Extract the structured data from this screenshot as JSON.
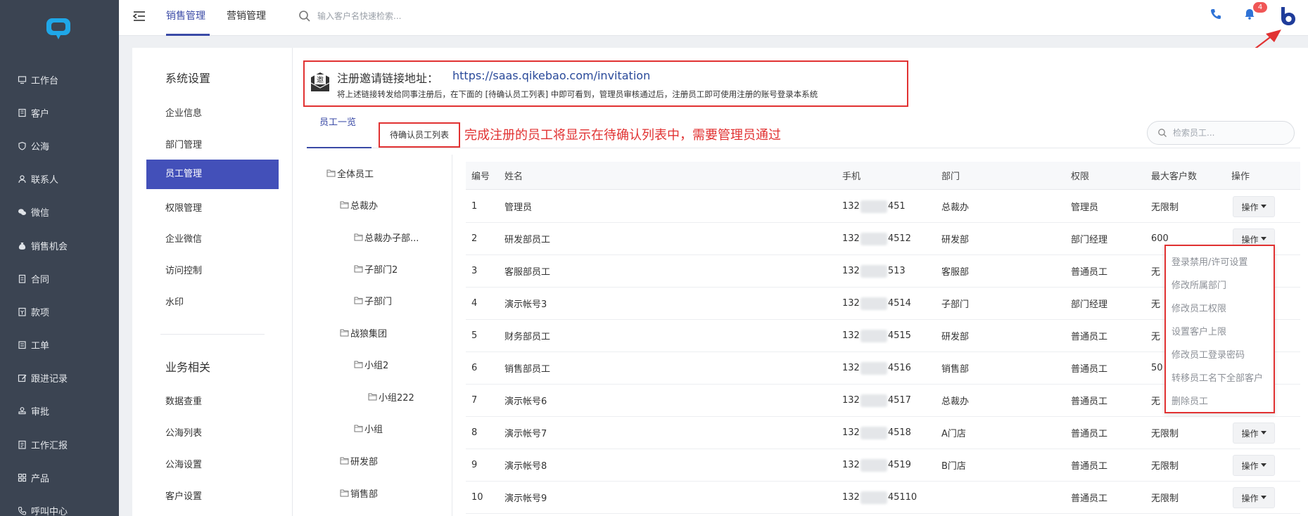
{
  "sidebar": {
    "items": [
      {
        "label": "工作台",
        "icon": "monitor-icon"
      },
      {
        "label": "客户",
        "icon": "building-icon"
      },
      {
        "label": "公海",
        "icon": "shield-icon"
      },
      {
        "label": "联系人",
        "icon": "person-icon"
      },
      {
        "label": "微信",
        "icon": "wechat-icon"
      },
      {
        "label": "销售机会",
        "icon": "money-bag-icon"
      },
      {
        "label": "合同",
        "icon": "document-icon"
      },
      {
        "label": "款项",
        "icon": "receipt-icon"
      },
      {
        "label": "工单",
        "icon": "ticket-icon"
      },
      {
        "label": "跟进记录",
        "icon": "edit-icon"
      },
      {
        "label": "审批",
        "icon": "stamp-icon"
      },
      {
        "label": "工作汇报",
        "icon": "report-icon"
      },
      {
        "label": "产品",
        "icon": "grid-icon"
      },
      {
        "label": "呼叫中心",
        "icon": "phone-icon"
      }
    ]
  },
  "topbar": {
    "tabs": [
      "销售管理",
      "营销管理"
    ],
    "active_tab": "销售管理",
    "search_placeholder": "输入客户名快速检索...",
    "notification_count": "4"
  },
  "settings_nav": {
    "group1_title": "系统设置",
    "group1_items": [
      "企业信息",
      "部门管理",
      "员工管理",
      "权限管理",
      "企业微信",
      "访问控制",
      "水印"
    ],
    "active_item": "员工管理",
    "group2_title": "业务相关",
    "group2_items": [
      "数据查重",
      "公海列表",
      "公海设置",
      "客户设置"
    ]
  },
  "invite": {
    "label": "注册邀请链接地址：",
    "url": "https://saas.qikebao.com/invitation",
    "description": "将上述链接转发给同事注册后，在下面的 [待确认员工列表] 中即可看到，管理员审核通过后，注册员工即可使用注册的账号登录本系统"
  },
  "tabs": {
    "staff_list": "员工一览",
    "pending_list": "待确认员工列表",
    "annotation": "完成注册的员工将显示在待确认列表中，需要管理员通过"
  },
  "staff_search_placeholder": "检索员工...",
  "tree": [
    {
      "label": "全体员工",
      "level": 0
    },
    {
      "label": "总裁办",
      "level": 1
    },
    {
      "label": "总裁办子部...",
      "level": 2
    },
    {
      "label": "子部门2",
      "level": 2
    },
    {
      "label": "子部门",
      "level": 2
    },
    {
      "label": "战狼集团",
      "level": 1
    },
    {
      "label": "小组2",
      "level": 2
    },
    {
      "label": "小组222",
      "level": 3
    },
    {
      "label": "小组",
      "level": 2
    },
    {
      "label": "研发部",
      "level": 1
    },
    {
      "label": "销售部",
      "level": 1
    }
  ],
  "table": {
    "columns": [
      "编号",
      "姓名",
      "手机",
      "部门",
      "权限",
      "最大客户数",
      "操作"
    ],
    "op_label": "操作",
    "rows": [
      {
        "id": "1",
        "name": "管理员",
        "phone_prefix": "132",
        "phone_suffix": "451",
        "dept": "总裁办",
        "role": "管理员",
        "max": "无限制"
      },
      {
        "id": "2",
        "name": "研发部员工",
        "phone_prefix": "132",
        "phone_suffix": "4512",
        "dept": "研发部",
        "role": "部门经理",
        "max": "600"
      },
      {
        "id": "3",
        "name": "客服部员工",
        "phone_prefix": "132",
        "phone_suffix": "513",
        "dept": "客服部",
        "role": "普通员工",
        "max": "无"
      },
      {
        "id": "4",
        "name": "演示帐号3",
        "phone_prefix": "132",
        "phone_suffix": "4514",
        "dept": "子部门",
        "role": "部门经理",
        "max": "无"
      },
      {
        "id": "5",
        "name": "财务部员工",
        "phone_prefix": "132",
        "phone_suffix": "4515",
        "dept": "研发部",
        "role": "普通员工",
        "max": "无"
      },
      {
        "id": "6",
        "name": "销售部员工",
        "phone_prefix": "132",
        "phone_suffix": "4516",
        "dept": "销售部",
        "role": "普通员工",
        "max": "50"
      },
      {
        "id": "7",
        "name": "演示帐号6",
        "phone_prefix": "132",
        "phone_suffix": "4517",
        "dept": "总裁办",
        "role": "普通员工",
        "max": "无"
      },
      {
        "id": "8",
        "name": "演示帐号7",
        "phone_prefix": "132",
        "phone_suffix": "4518",
        "dept": "A门店",
        "role": "普通员工",
        "max": "无限制"
      },
      {
        "id": "9",
        "name": "演示帐号8",
        "phone_prefix": "132",
        "phone_suffix": "4519",
        "dept": "B门店",
        "role": "普通员工",
        "max": "无限制"
      },
      {
        "id": "10",
        "name": "演示帐号9",
        "phone_prefix": "132",
        "phone_suffix": "45110",
        "dept": "",
        "role": "普通员工",
        "max": "无限制"
      }
    ]
  },
  "dropdown": {
    "items": [
      "登录禁用/许可设置",
      "修改所属部门",
      "修改员工权限",
      "设置客户上限",
      "修改员工登录密码",
      "转移员工名下全部客户",
      "删除员工"
    ]
  },
  "colors": {
    "sidebar_bg": "#3b4452",
    "accent": "#3a4aa6",
    "active_nav": "#4350b9",
    "annotation_red": "#e13232",
    "badge_red": "#f05656"
  }
}
